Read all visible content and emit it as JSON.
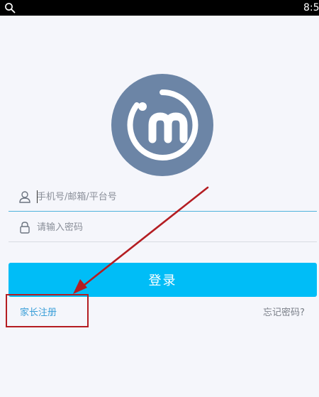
{
  "status_bar": {
    "time": "8:5"
  },
  "logo": {
    "brand_color": "#6c85a6"
  },
  "form": {
    "username_placeholder": "手机号/邮箱/平台号",
    "password_placeholder": "请输入密码",
    "login_label": "登录"
  },
  "links": {
    "register_label": "家长注册",
    "forgot_label": "忘记密码?"
  },
  "colors": {
    "accent": "#00bdf7",
    "link": "#3a9fd8",
    "annotation": "#b41d22"
  },
  "icons": {
    "status_search": "search-icon",
    "username": "user-icon",
    "password": "lock-icon"
  }
}
